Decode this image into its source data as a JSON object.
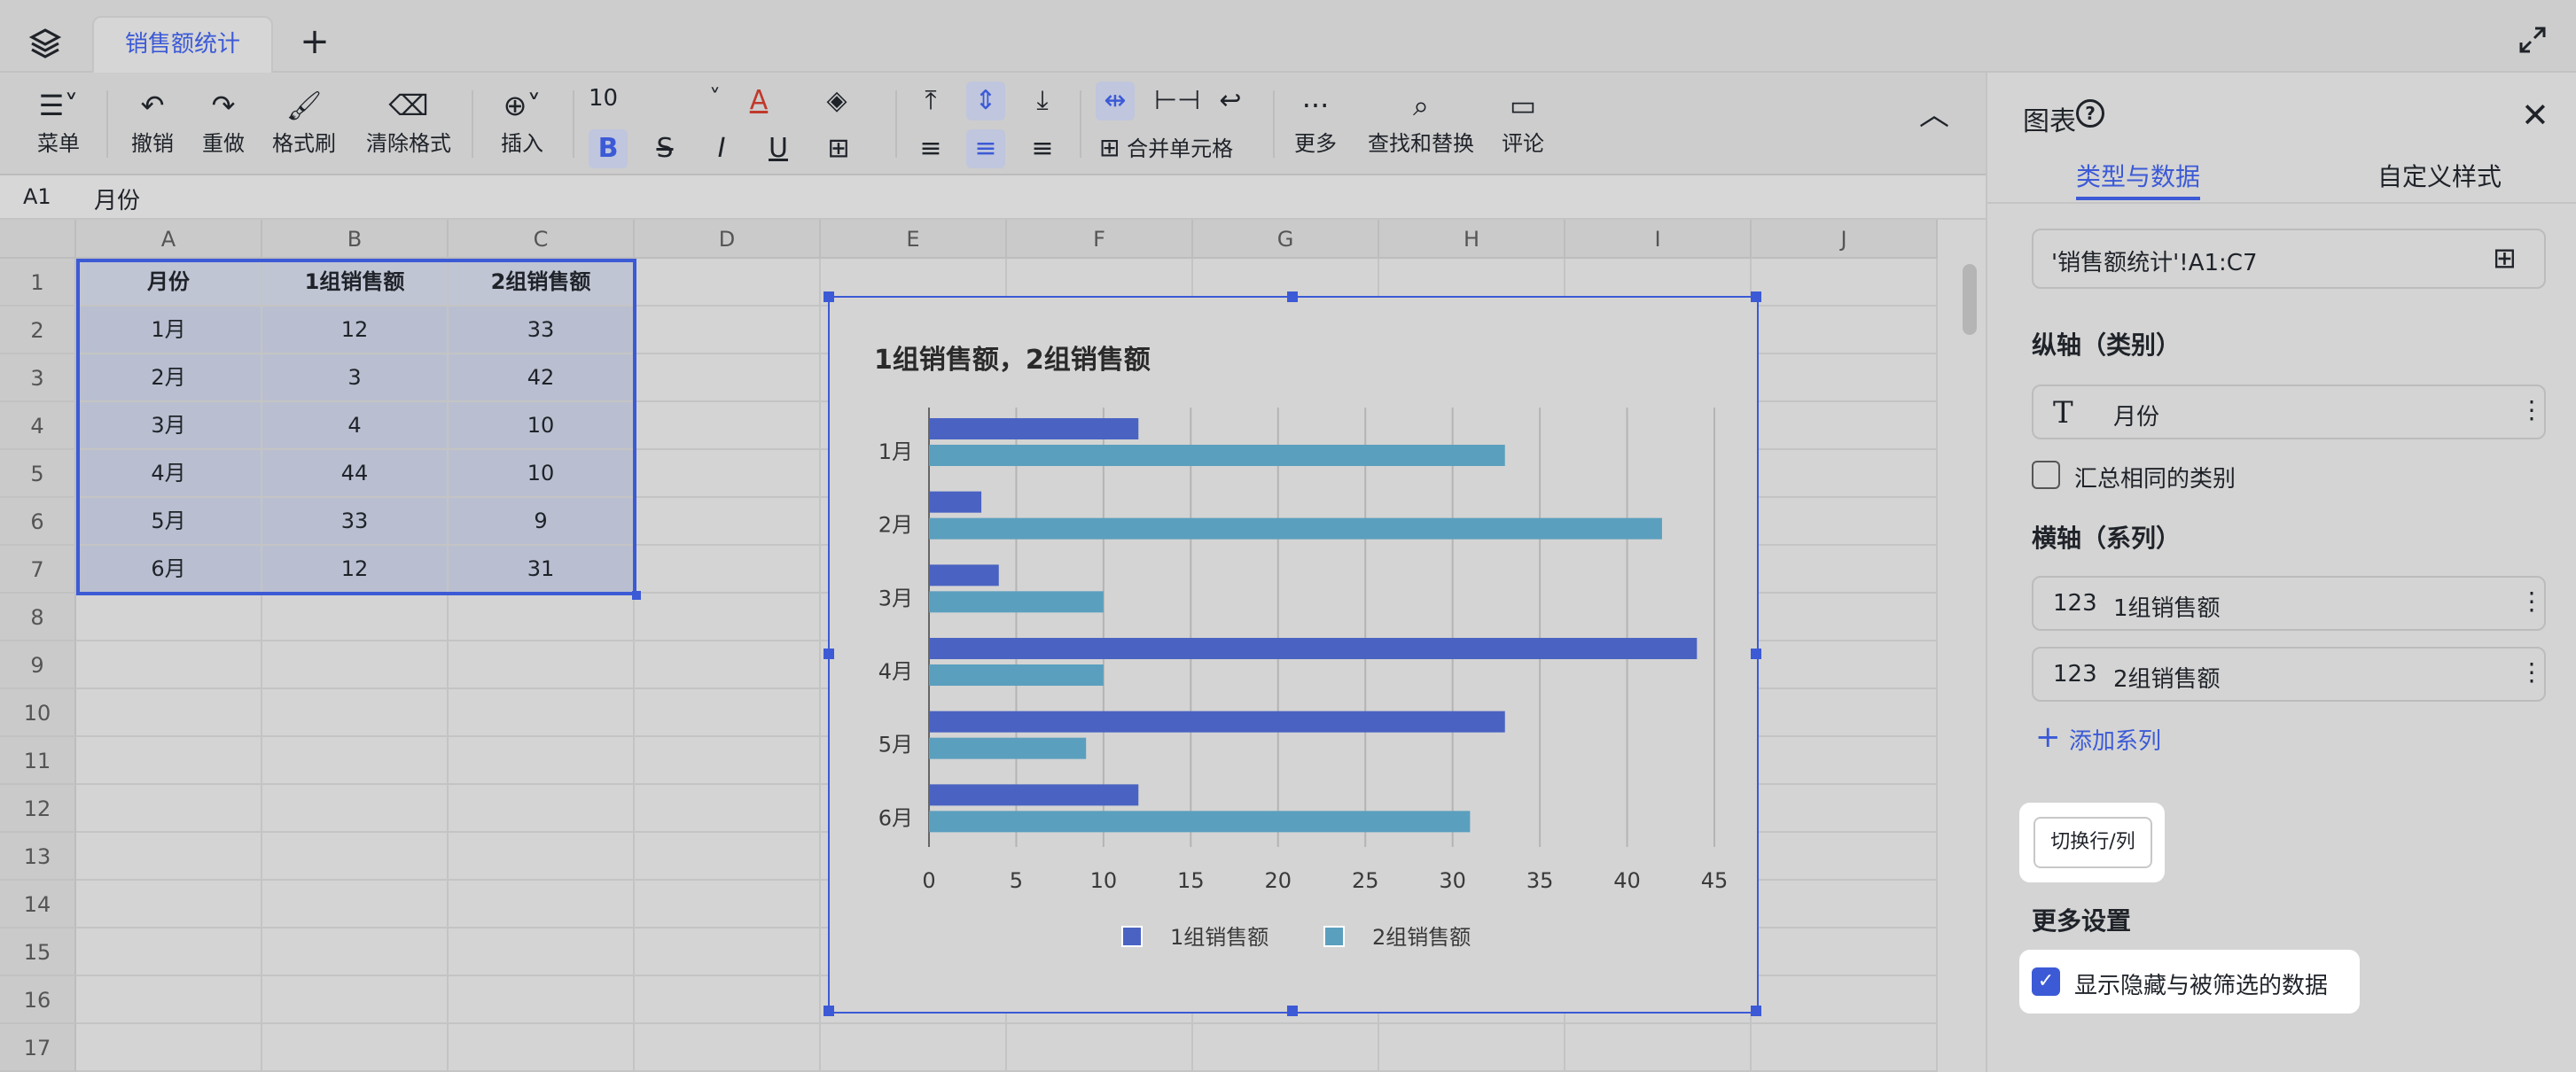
{
  "tabs": {
    "active": "销售额统计",
    "add": "+"
  },
  "toolbar": {
    "menu": "菜单",
    "undo": "撤销",
    "redo": "重做",
    "format_painter": "格式刷",
    "clear_format": "清除格式",
    "insert": "插入",
    "font_size": "10",
    "merge": "合并单元格",
    "more": "更多",
    "find_replace": "查找和替换",
    "comment": "评论"
  },
  "formula_bar": {
    "cell_ref": "A1",
    "value": "月份"
  },
  "sheet": {
    "columns": [
      "A",
      "B",
      "C",
      "D",
      "E",
      "F",
      "G",
      "H",
      "I",
      "J"
    ],
    "rows": [
      "1",
      "2",
      "3",
      "4",
      "5",
      "6",
      "7",
      "8",
      "9",
      "10",
      "11",
      "12",
      "13",
      "14",
      "15",
      "16",
      "17"
    ],
    "header": [
      "月份",
      "1组销售额",
      "2组销售额"
    ],
    "data": [
      [
        "1月",
        "12",
        "33"
      ],
      [
        "2月",
        "3",
        "42"
      ],
      [
        "3月",
        "4",
        "10"
      ],
      [
        "4月",
        "44",
        "10"
      ],
      [
        "5月",
        "33",
        "9"
      ],
      [
        "6月",
        "12",
        "31"
      ]
    ]
  },
  "chart_data": {
    "type": "bar",
    "orientation": "horizontal",
    "title": "1组销售额，2组销售额",
    "categories": [
      "1月",
      "2月",
      "3月",
      "4月",
      "5月",
      "6月"
    ],
    "series": [
      {
        "name": "1组销售额",
        "values": [
          12,
          3,
          4,
          44,
          33,
          12
        ],
        "color": "#4a63c2"
      },
      {
        "name": "2组销售额",
        "values": [
          33,
          42,
          10,
          10,
          9,
          31
        ],
        "color": "#5b9fbe"
      }
    ],
    "xlim": [
      0,
      45
    ],
    "xticks": [
      "0",
      "5",
      "10",
      "15",
      "20",
      "25",
      "30",
      "35",
      "40",
      "45"
    ],
    "grid": true,
    "legend": "bottom"
  },
  "panel": {
    "title": "图表",
    "tab_data": "类型与数据",
    "tab_style": "自定义样式",
    "range": "'销售额统计'!A1:C7",
    "vaxis_label": "纵轴（类别）",
    "vaxis_field": "月份",
    "aggregate_label": "汇总相同的类别",
    "haxis_label": "横轴（系列）",
    "series_icon": "123",
    "series1": "1组销售额",
    "series2": "2组销售额",
    "add_series": "添加系列",
    "switch_button": "切换行/列",
    "more_settings": "更多设置",
    "show_hidden": "显示隐藏与被筛选的数据"
  },
  "colors": {
    "accent": "#3c5ad6"
  }
}
